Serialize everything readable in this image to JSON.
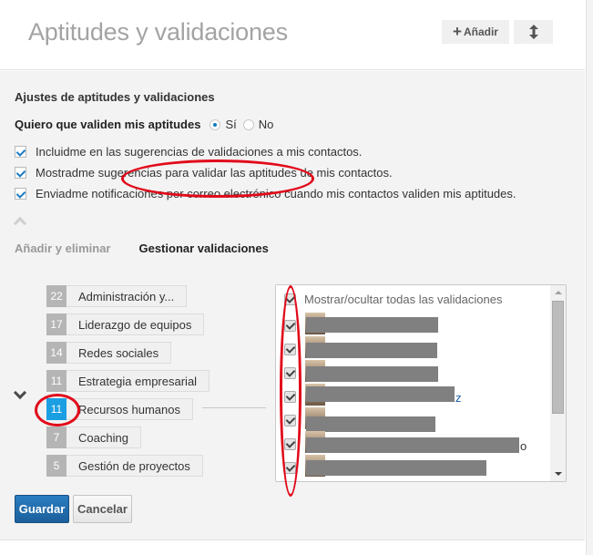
{
  "header": {
    "title": "Aptitudes y validaciones",
    "add_label": "Añadir",
    "add_icon": "plus-icon",
    "reorder_icon": "up-down-arrow-icon"
  },
  "settings": {
    "title": "Ajustes de aptitudes y validaciones",
    "question": "Quiero que validen mis aptitudes",
    "options": [
      {
        "label": "Sí",
        "selected": true
      },
      {
        "label": "No",
        "selected": false
      }
    ],
    "checkboxes": [
      {
        "label": "Incluidme en las sugerencias de validaciones a mis contactos.",
        "checked": true
      },
      {
        "label": "Mostradme sugerencias para validar las aptitudes de mis contactos.",
        "checked": true
      },
      {
        "label": "Enviadme notificaciones por correo electrónico cuando mis contactos validen mis aptitudes.",
        "checked": true
      }
    ]
  },
  "tabs": [
    {
      "label": "Añadir y eliminar",
      "active": false
    },
    {
      "label": "Gestionar validaciones",
      "active": true
    }
  ],
  "skills": [
    {
      "count": "22",
      "name": "Administración y...",
      "selected": false
    },
    {
      "count": "17",
      "name": "Liderazgo de equipos",
      "selected": false
    },
    {
      "count": "14",
      "name": "Redes sociales",
      "selected": false
    },
    {
      "count": "11",
      "name": "Estrategia empresarial",
      "selected": false
    },
    {
      "count": "11",
      "name": "Recursos humanos",
      "selected": true
    },
    {
      "count": "7",
      "name": "Coaching",
      "selected": false
    },
    {
      "count": "5",
      "name": "Gestión de proyectos",
      "selected": false
    }
  ],
  "validations": {
    "toggle_all_label": "Mostrar/ocultar todas las validaciones",
    "toggle_all_checked": true,
    "entries": [
      {
        "name": "[redacted]",
        "checked": true,
        "trailing": ""
      },
      {
        "name": "[redacted]",
        "checked": true,
        "trailing": ""
      },
      {
        "name": "[redacted]",
        "checked": true,
        "trailing": ""
      },
      {
        "name": "[redacted]",
        "checked": true,
        "trailing": "z"
      },
      {
        "name": "[redacted]",
        "checked": true,
        "trailing": ""
      },
      {
        "name": "[redacted]",
        "checked": true,
        "trailing": "o"
      },
      {
        "name": "[redacted]",
        "checked": true,
        "trailing": ""
      }
    ]
  },
  "actions": {
    "save_label": "Guardar",
    "cancel_label": "Cancelar"
  },
  "colors": {
    "accent_blue": "#1b9fe2",
    "primary_button": "#1c5f9b",
    "annotation_red": "#e10a1a"
  }
}
